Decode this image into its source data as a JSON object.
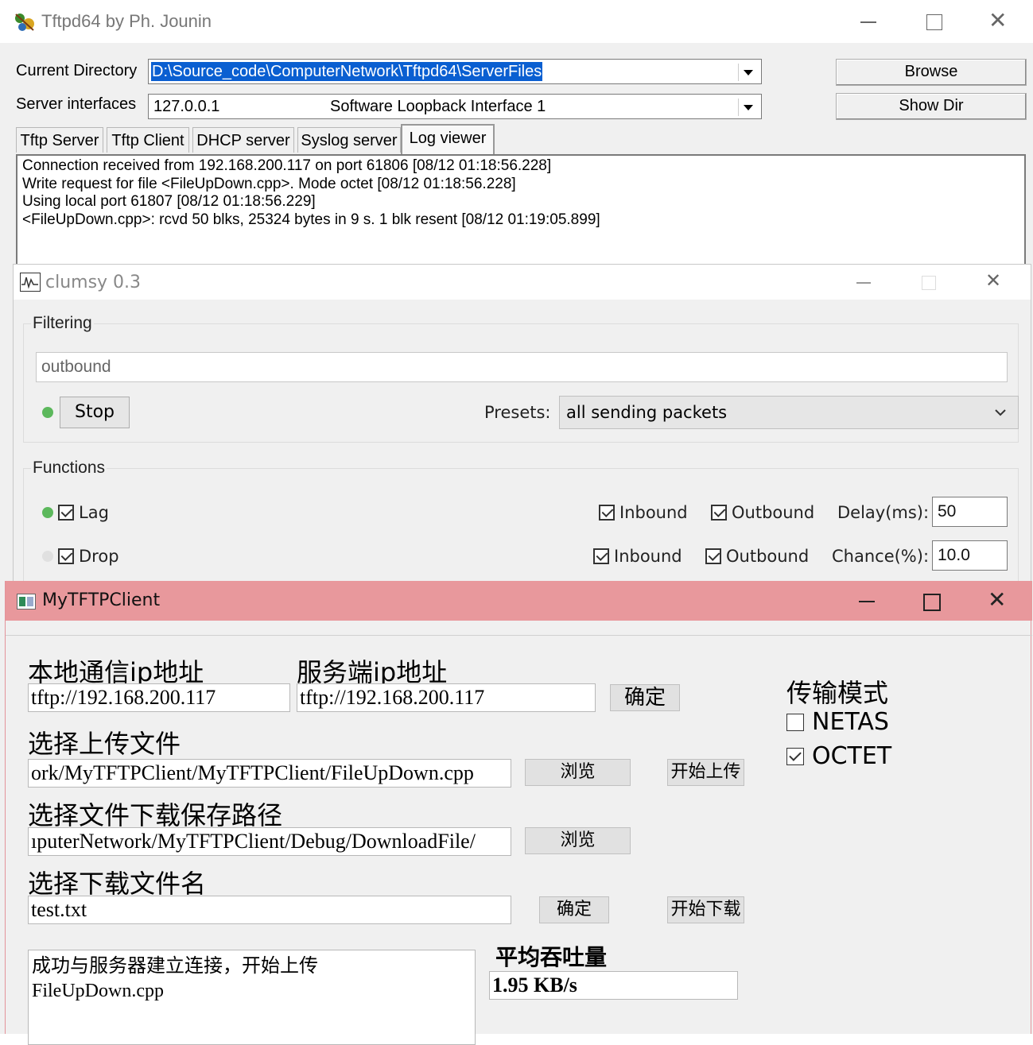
{
  "tftpd": {
    "title": "Tftpd64 by Ph. Jounin",
    "current_directory_label": "Current Directory",
    "current_directory_value": "D:\\Source_code\\ComputerNetwork\\Tftpd64\\ServerFiles",
    "server_interfaces_label": "Server interfaces",
    "server_interface_ip": "127.0.0.1",
    "server_interface_name": "Software Loopback Interface 1",
    "browse_label": "Browse",
    "show_dir_label": "Show Dir",
    "tabs": [
      {
        "label": "Tftp Server"
      },
      {
        "label": "Tftp Client"
      },
      {
        "label": "DHCP server"
      },
      {
        "label": "Syslog server"
      },
      {
        "label": "Log viewer"
      }
    ],
    "active_tab": "Log viewer",
    "log_lines": [
      "Connection received from 192.168.200.117 on port 61806 [08/12 01:18:56.228]",
      "Write request for file <FileUpDown.cpp>. Mode octet [08/12 01:18:56.228]",
      "Using local port 61807 [08/12 01:18:56.229]",
      "<FileUpDown.cpp>: rcvd 50 blks, 25324 bytes in 9 s. 1 blk resent [08/12 01:19:05.899]"
    ]
  },
  "clumsy": {
    "title": "clumsy 0.3",
    "filtering_label": "Filtering",
    "filter_value": "outbound",
    "stop_label": "Stop",
    "presets_label": "Presets:",
    "preset_value": "all sending packets",
    "functions_label": "Functions",
    "functions": [
      {
        "name": "Lag",
        "checked": true,
        "inbound_label": "Inbound",
        "inbound": true,
        "outbound_label": "Outbound",
        "outbound": true,
        "param_label": "Delay(ms):",
        "param_value": "50"
      },
      {
        "name": "Drop",
        "checked": true,
        "inbound_label": "Inbound",
        "inbound": true,
        "outbound_label": "Outbound",
        "outbound": true,
        "param_label": "Chance(%):",
        "param_value": "10.0"
      }
    ],
    "status_active_color": "#5cb85c",
    "status_inactive_color": "#e0e0e0"
  },
  "mytftp": {
    "title": "MyTFTPClient",
    "titlebar_color": "#e8989c",
    "local_ip_label": "本地通信ip地址",
    "local_ip_value": "tftp://192.168.200.117",
    "server_ip_label": "服务端ip地址",
    "server_ip_value": "tftp://192.168.200.117",
    "confirm_label": "确定",
    "mode_label": "传输模式",
    "mode_options": [
      {
        "label": "NETAS",
        "checked": false
      },
      {
        "label": "OCTET",
        "checked": true
      }
    ],
    "upload_file_label": "选择上传文件",
    "upload_file_value": "ork/MyTFTPClient/MyTFTPClient/FileUpDown.cpp",
    "browse_label": "浏览",
    "start_upload_label": "开始上传",
    "save_path_label": "选择文件下载保存路径",
    "save_path_value": "ıputerNetwork/MyTFTPClient/Debug/DownloadFile/",
    "download_name_label": "选择下载文件名",
    "download_name_value": "test.txt",
    "start_download_label": "开始下载",
    "status_lines": [
      "成功与服务器建立连接，开始上传",
      "FileUpDown.cpp"
    ],
    "throughput_label": "平均吞吐量",
    "throughput_value": "1.95 KB/s"
  }
}
